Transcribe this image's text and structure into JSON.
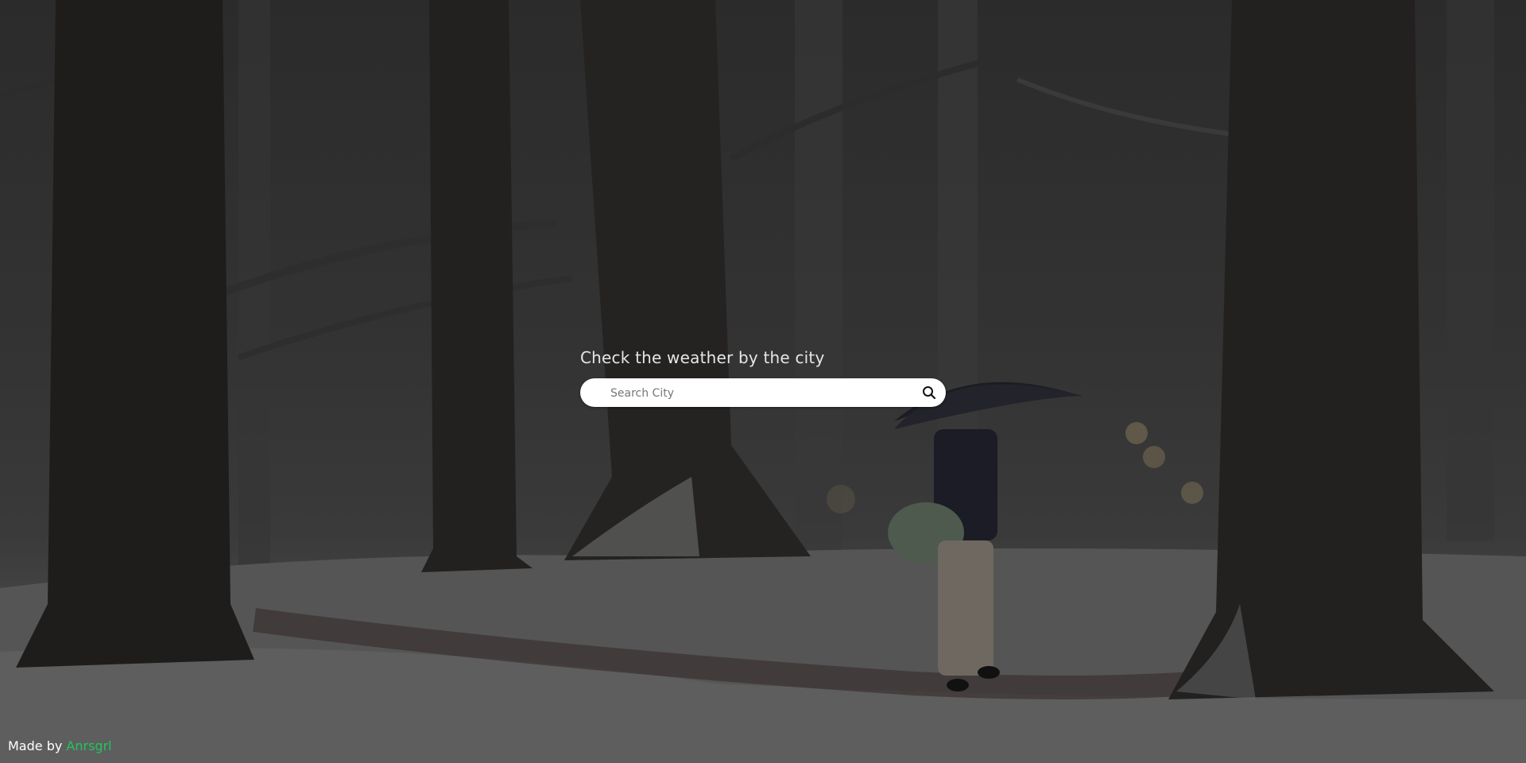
{
  "main": {
    "heading": "Check the weather by the city",
    "search": {
      "placeholder": "Search City",
      "value": "",
      "icon": "search-icon"
    }
  },
  "footer": {
    "made_by_label": "Made by",
    "author": "Anrsgrl"
  },
  "colors": {
    "accent": "#22c55e",
    "heading_text": "#e6e6e6",
    "search_bg": "#ffffff"
  }
}
